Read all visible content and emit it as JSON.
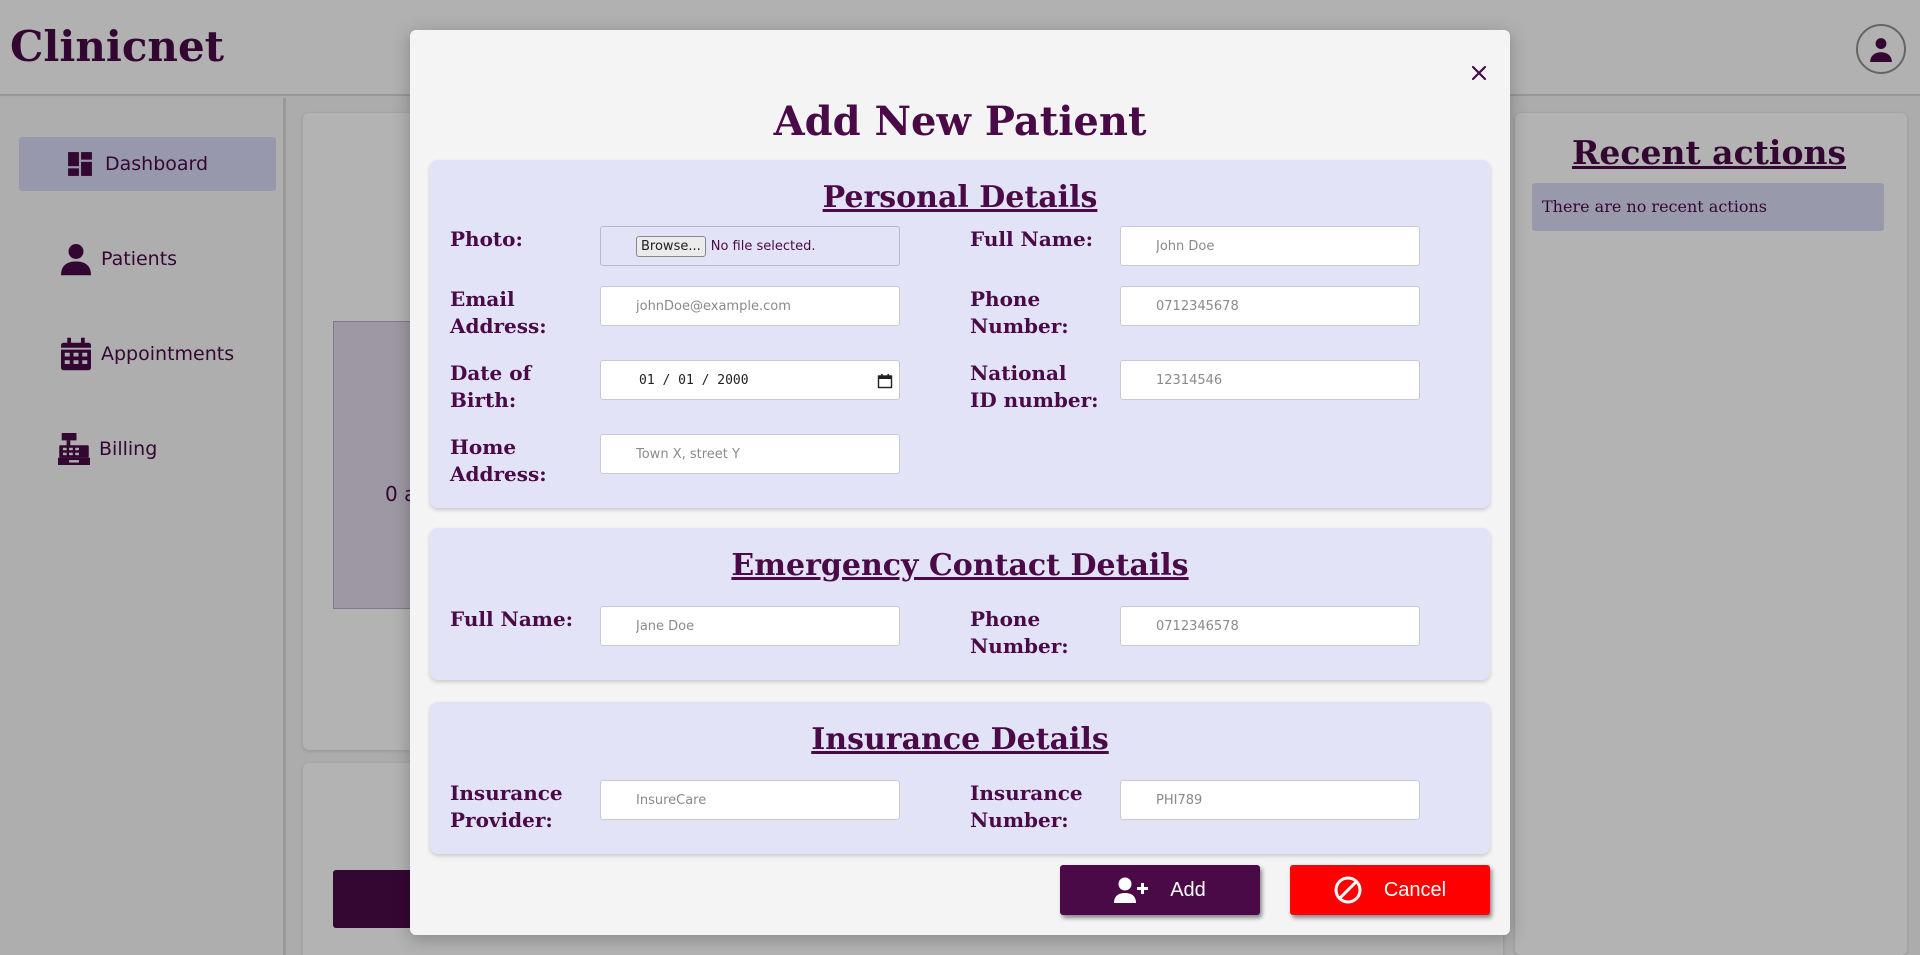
{
  "app": {
    "brand": "Clinicnet"
  },
  "header": {
    "profile_icon": "user-icon"
  },
  "sidebar": {
    "items": [
      {
        "label": "Dashboard",
        "icon": "dashboard-icon",
        "active": true
      },
      {
        "label": "Patients",
        "icon": "user-icon",
        "active": false
      },
      {
        "label": "Appointments",
        "icon": "calendar-icon",
        "active": false
      },
      {
        "label": "Billing",
        "icon": "cash-register-icon",
        "active": false
      }
    ]
  },
  "dashboard": {
    "count_text": "0 a"
  },
  "recent": {
    "title": "Recent actions",
    "empty_text": "There are no recent actions"
  },
  "modal": {
    "title": "Add New Patient",
    "close_icon": "close-icon",
    "personal": {
      "title": "Personal Details",
      "photo_label": "Photo:",
      "browse_label": "Browse...",
      "file_status": "No file selected.",
      "fullname_label": "Full Name:",
      "fullname_placeholder": "John Doe",
      "email_label": "Email Address:",
      "email_placeholder": "johnDoe@example.com",
      "phone_label": "Phone Number:",
      "phone_placeholder": "0712345678",
      "dob_label": "Date of Birth:",
      "dob_value": "01 / 01 / 2000",
      "national_id_label": "National ID number:",
      "national_id_placeholder": "12314546",
      "home_address_label": "Home Address:",
      "home_address_placeholder": "Town X, street Y"
    },
    "emergency": {
      "title": "Emergency Contact Details",
      "fullname_label": "Full Name:",
      "fullname_placeholder": "Jane Doe",
      "phone_label": "Phone Number:",
      "phone_placeholder": "0712346578"
    },
    "insurance": {
      "title": "Insurance Details",
      "provider_label": "Insurance Provider:",
      "provider_placeholder": "InsureCare",
      "number_label": "Insurance Number:",
      "number_placeholder": "PHI789"
    },
    "actions": {
      "add_label": "Add",
      "cancel_label": "Cancel"
    }
  },
  "colors": {
    "brand": "#4a0a48",
    "section_bg": "#e3e3f7",
    "cancel": "#ff0000",
    "active_nav": "#d6d6f3"
  }
}
